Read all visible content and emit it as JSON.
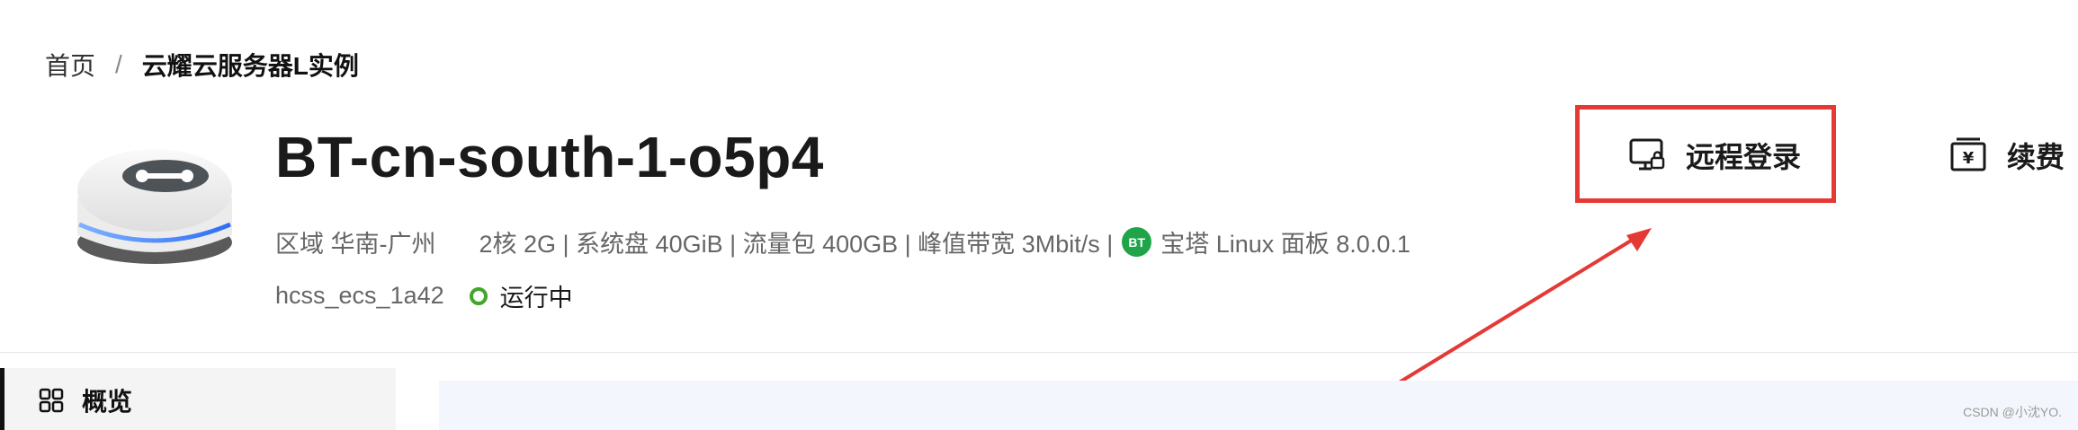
{
  "breadcrumb": {
    "home": "首页",
    "separator": "/",
    "current": "云耀云服务器L实例"
  },
  "server": {
    "name": "BT-cn-south-1-o5p4",
    "region": "区域 华南-广州",
    "specs": "2核  2G | 系统盘 40GiB | 流量包 400GB | 峰值带宽 3Mbit/s |",
    "panel_badge": "BT",
    "panel": "宝塔 Linux 面板 8.0.0.1",
    "instance_id": "hcss_ecs_1a42",
    "status": "运行中",
    "status_color": "#41a62a"
  },
  "actions": {
    "remote_login": "远程登录",
    "renew": "续费"
  },
  "annotation": {
    "highlight_color": "#e53935"
  },
  "sidebar": {
    "overview": "概览"
  },
  "watermark": "CSDN @小沈YO."
}
